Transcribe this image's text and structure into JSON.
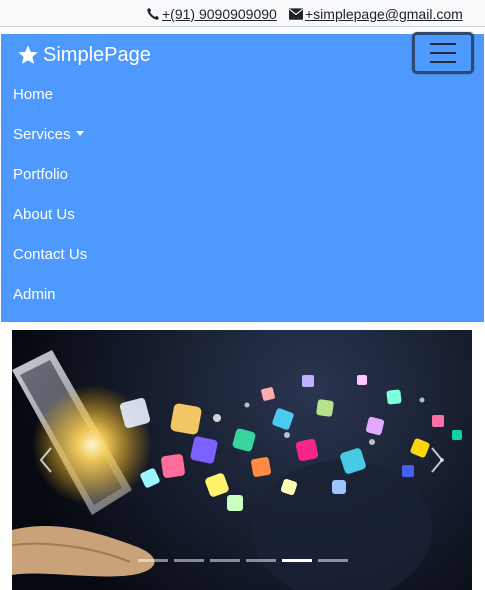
{
  "contact": {
    "phone": "+(91) 9090909090",
    "email": "+simplepage@gmail.com"
  },
  "navbar": {
    "brand": "SimplePage",
    "items": [
      {
        "label": "Home"
      },
      {
        "label": "Services",
        "has_dropdown": true
      },
      {
        "label": "Portfolio"
      },
      {
        "label": "About Us"
      },
      {
        "label": "Contact Us"
      },
      {
        "label": "Admin"
      }
    ],
    "toggler_icon": "hamburger-icon",
    "brand_icon": "star-icon"
  },
  "carousel": {
    "slide_count": 6,
    "active_index": 4,
    "prev_icon": "chevron-left-icon",
    "next_icon": "chevron-right-icon"
  },
  "colors": {
    "navbar_bg": "#4d99fd",
    "topbar_bg": "#f8f9fa"
  }
}
